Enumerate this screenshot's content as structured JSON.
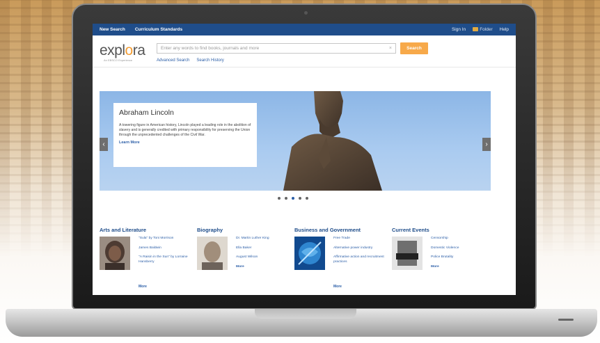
{
  "topbar": {
    "links": [
      "New Search",
      "Curriculum Standards"
    ],
    "right": [
      "Sign In",
      "Folder",
      "Help"
    ]
  },
  "header": {
    "logo_text_a": "expl",
    "logo_text_o": "o",
    "logo_text_b": "ra",
    "logo_tagline": "An EBSCO Experience",
    "search_placeholder": "Enter any words to find books, journals and more",
    "search_button": "Search",
    "links": [
      "Advanced Search",
      "Search History"
    ]
  },
  "hero": {
    "title": "Abraham Lincoln",
    "text": "A towering figure in American history, Lincoln played a leading role in the abolition of slavery and is generally credited with primary responsibility for preserving the Union through the unprecedented challenges of the Civil War.",
    "more": "Learn More",
    "prev_icon": "‹",
    "next_icon": "›",
    "dots": 5,
    "active_dot": 2
  },
  "categories": [
    {
      "title": "Arts and Literature",
      "links": [
        "\"Sula\" by Toni Morrison",
        "James Baldwin",
        "\"A Raisin in the Sun\" by Lorraine Hansberry"
      ],
      "more": "More"
    },
    {
      "title": "Biography",
      "links": [
        "Dr. Martin Luther King",
        "Ella Baker",
        "August Wilson"
      ],
      "more": "More"
    },
    {
      "title": "Business and Government",
      "links": [
        "Free Trade",
        "Alternative power industry",
        "Affirmative action and recruitment practices"
      ],
      "more": "More"
    },
    {
      "title": "Current Events",
      "links": [
        "Censorship",
        "Domestic Violence",
        "Police Brutality"
      ],
      "more": "More"
    }
  ],
  "colors": {
    "topbar": "#1f4d8a",
    "accent": "#f39c33",
    "link": "#2b5ea7"
  }
}
